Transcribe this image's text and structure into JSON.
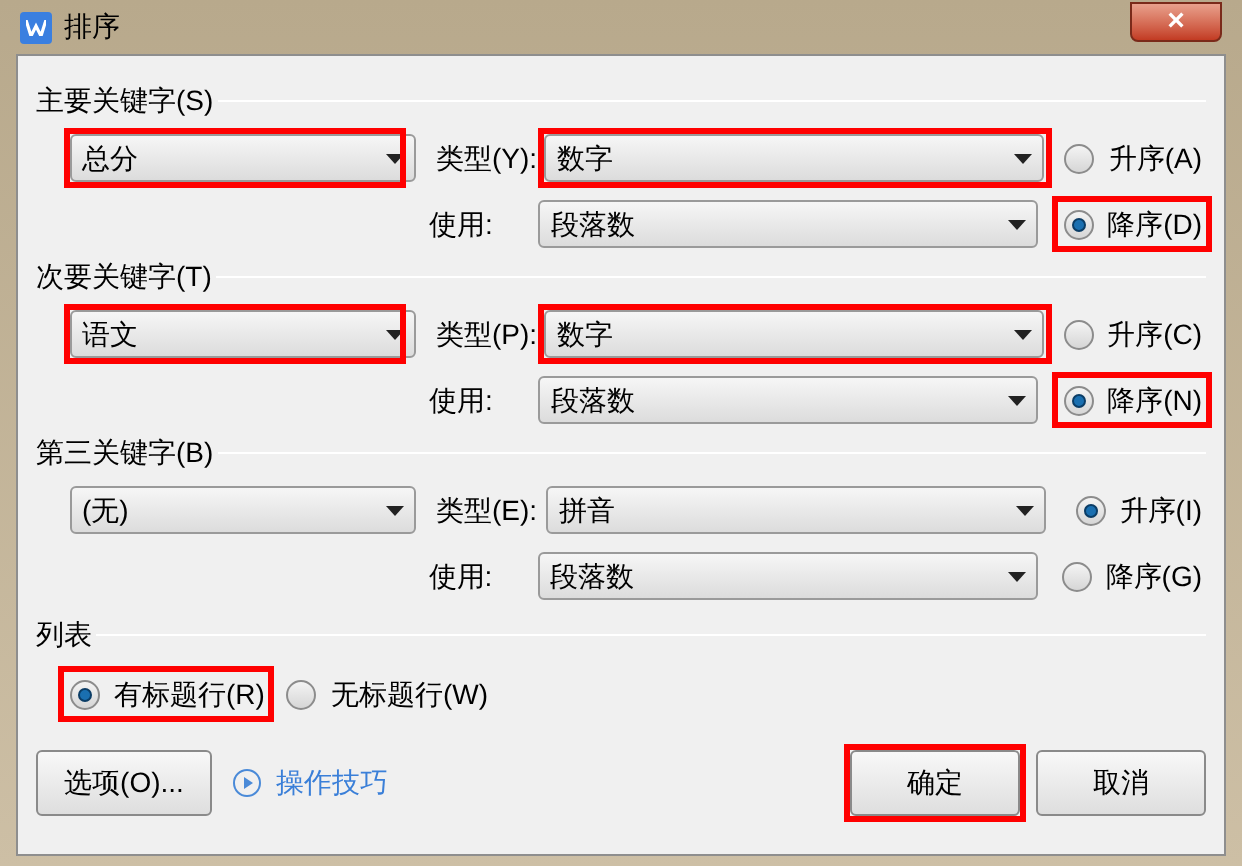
{
  "window": {
    "title": "排序",
    "close": "×"
  },
  "sort_keys": [
    {
      "label": "主要关键字(S)",
      "field": {
        "value": "总分",
        "highlighted": true
      },
      "type_label": "类型(Y):",
      "type": {
        "value": "数字",
        "highlighted": true
      },
      "use_label": "使用:",
      "use": {
        "value": "段落数"
      },
      "orders": [
        {
          "label": "升序(A)",
          "selected": false
        },
        {
          "label": "降序(D)",
          "selected": true,
          "highlighted": true
        }
      ]
    },
    {
      "label": "次要关键字(T)",
      "field": {
        "value": "语文",
        "highlighted": true
      },
      "type_label": "类型(P):",
      "type": {
        "value": "数字",
        "highlighted": true
      },
      "use_label": "使用:",
      "use": {
        "value": "段落数"
      },
      "orders": [
        {
          "label": "升序(C)",
          "selected": false
        },
        {
          "label": "降序(N)",
          "selected": true,
          "highlighted": true
        }
      ]
    },
    {
      "label": "第三关键字(B)",
      "field": {
        "value": "(无)"
      },
      "type_label": "类型(E):",
      "type": {
        "value": "拼音"
      },
      "use_label": "使用:",
      "use": {
        "value": "段落数"
      },
      "orders": [
        {
          "label": "升序(I)",
          "selected": true
        },
        {
          "label": "降序(G)",
          "selected": false
        }
      ]
    }
  ],
  "list": {
    "label": "列表",
    "options": [
      {
        "label": "有标题行(R)",
        "selected": true,
        "highlighted": true
      },
      {
        "label": "无标题行(W)",
        "selected": false
      }
    ]
  },
  "options_button": "选项(O)...",
  "tips_link": "操作技巧",
  "buttons": [
    {
      "label": "确定",
      "highlighted": true
    },
    {
      "label": "取消"
    }
  ]
}
